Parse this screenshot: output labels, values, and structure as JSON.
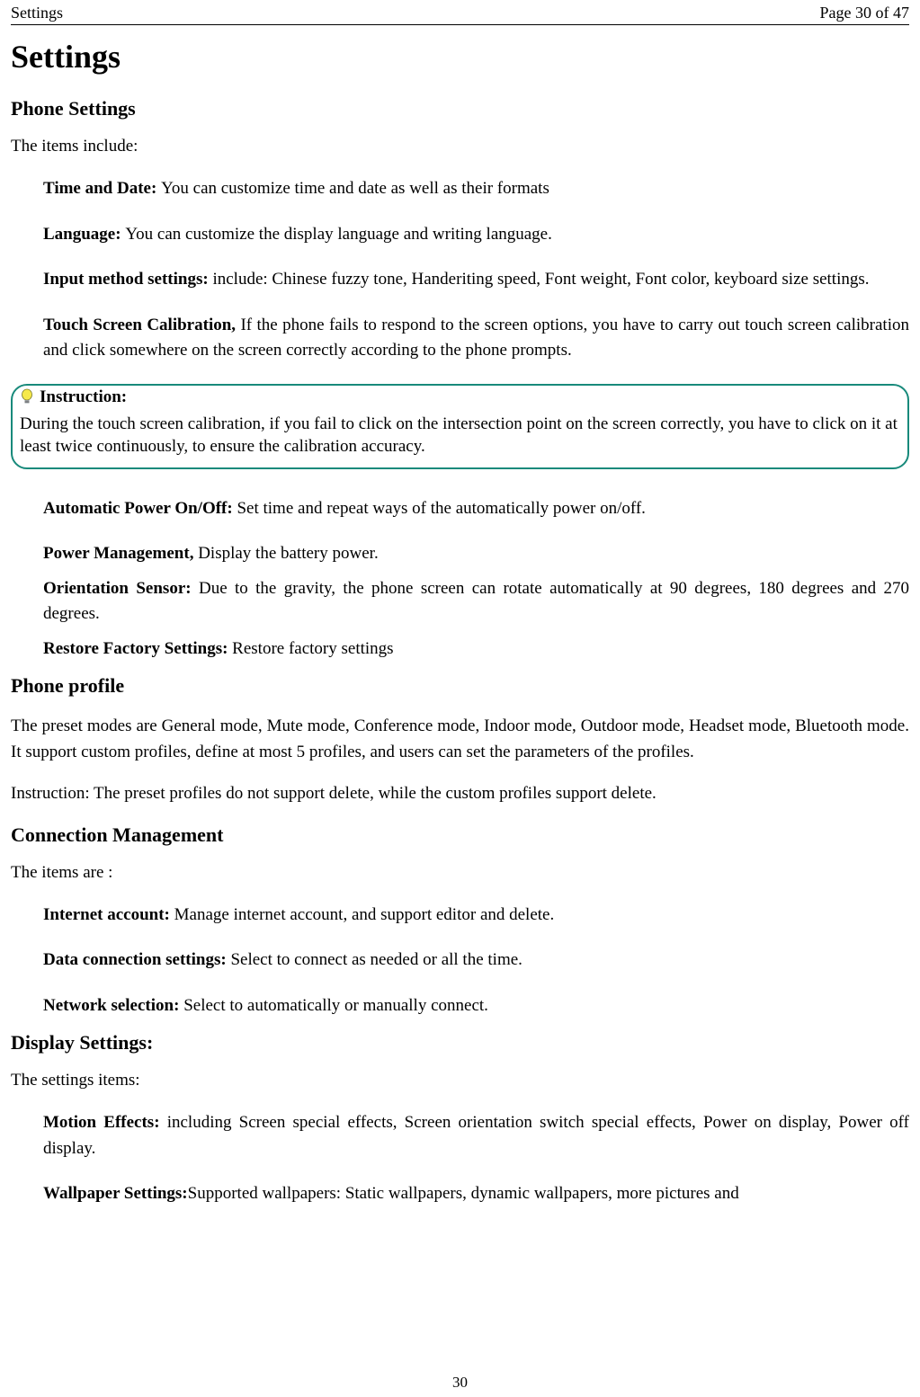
{
  "header": {
    "left": "Settings",
    "right": "Page 30 of 47"
  },
  "title": "Settings",
  "phone_settings": {
    "heading": "Phone Settings",
    "intro": "The items include:",
    "items": [
      {
        "bold": "Time and Date: ",
        "text": "You can customize time and date as well as their formats"
      },
      {
        "bold": "Language: ",
        "text": "You can customize the display language and writing language."
      },
      {
        "bold": "Input method settings: ",
        "text": "include: Chinese fuzzy tone, Handeriting speed, Font weight, Font color, keyboard size settings."
      },
      {
        "bold": "Touch Screen Calibration, ",
        "text": "If the phone fails to respond to the screen options, you have to carry out touch screen calibration and click somewhere on the screen correctly according to the phone prompts."
      }
    ]
  },
  "instruction": {
    "title": "Instruction:",
    "body": "During the touch screen calibration, if you fail to click on the intersection point on the screen correctly, you have to click on it at least twice continuously, to ensure the calibration accuracy."
  },
  "phone_settings2": {
    "items": [
      {
        "bold": "Automatic Power On/Off: ",
        "text": "Set time and repeat ways of the automatically power on/off."
      },
      {
        "bold": "Power Management, ",
        "text": "Display the battery power."
      },
      {
        "bold": "Orientation Sensor: ",
        "text": "Due to the gravity, the phone screen can rotate automatically at 90 degrees, 180 degrees and 270 degrees."
      },
      {
        "bold": "Restore Factory Settings: ",
        "text": "Restore factory settings"
      }
    ]
  },
  "phone_profile": {
    "heading": "Phone profile",
    "p1": "The preset modes are General mode, Mute mode, Conference mode, Indoor mode, Outdoor mode, Headset mode, Bluetooth mode. It support custom profiles, define at most 5 profiles, and users can set the parameters of the profiles.",
    "p2": "Instruction: The preset profiles do not support delete, while the custom profiles support delete."
  },
  "connection": {
    "heading": "Connection Management",
    "intro": "The items are :",
    "items": [
      {
        "bold": "Internet account: ",
        "text": "Manage internet account, and support editor and delete."
      },
      {
        "bold": "Data connection settings: ",
        "text": "Select to connect as needed or all the time."
      },
      {
        "bold": "Network selection: ",
        "text": "Select to automatically or manually connect."
      }
    ]
  },
  "display": {
    "heading": "Display Settings:",
    "intro": "The settings items:",
    "items": [
      {
        "bold": "Motion Effects: ",
        "text": "including Screen special effects, Screen orientation switch special effects, Power on display, Power off display."
      },
      {
        "bold": "Wallpaper Settings:",
        "text": "Supported wallpapers: Static wallpapers, dynamic wallpapers, more pictures and"
      }
    ]
  },
  "footer": {
    "page_number": "30"
  }
}
